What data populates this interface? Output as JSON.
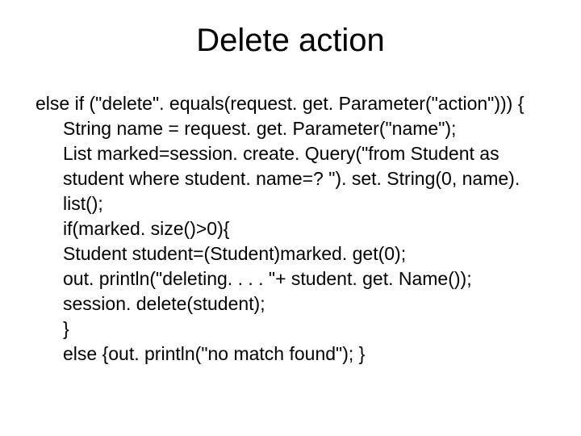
{
  "title": "Delete action",
  "code": {
    "l1": "else if  (\"delete\". equals(request. get. Parameter(\"action\"))) {",
    "l2": "String name = request. get. Parameter(\"name\");",
    "l3": "List marked=session. create. Query(\"from Student as",
    "l4": "student where student. name=? \"). set. String(0, name). list();",
    "l5": "if(marked. size()>0){",
    "l6": " Student student=(Student)marked. get(0);",
    "l7": "out. println(\"deleting. . . . \"+ student. get. Name());",
    "l8": "session. delete(student);",
    "l9": " }",
    "l10": "else {out. println(\"no match found\"); }"
  }
}
